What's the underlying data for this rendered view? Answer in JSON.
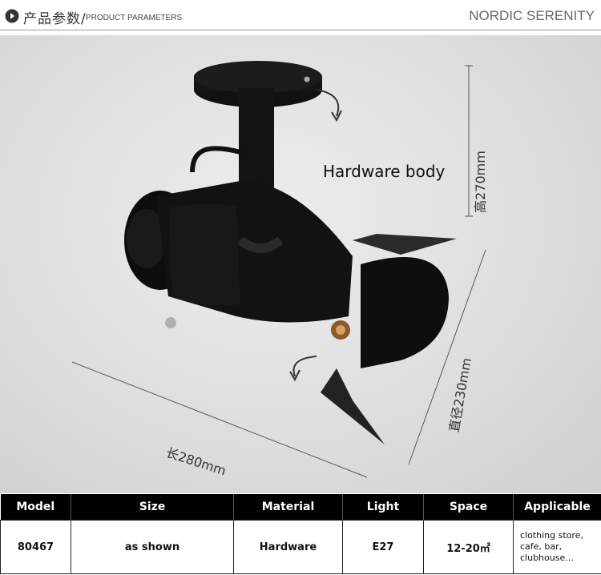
{
  "header": {
    "title_cn": "产品参数/",
    "title_en": "PRODUCT PARAMETERS",
    "brand": "NORDIC SERENITY",
    "icon": "play-circle-icon"
  },
  "photo": {
    "callout": "Hardware body",
    "dimensions": {
      "height": "高270mm",
      "diameter": "直径230mm",
      "length": "长280mm"
    }
  },
  "table": {
    "headers": [
      "Model",
      "Size",
      "Material",
      "Light",
      "Space",
      "Applicable"
    ],
    "row": {
      "model": "80467",
      "size": "as shown",
      "material": "Hardware",
      "light": "E27",
      "space": "12-20㎡",
      "applicable": "clothing store,\ncafe, bar,\nclubhouse..."
    }
  },
  "colors": {
    "table_header_bg": "#000000",
    "fixture_body": "#111111",
    "background": "#e2e2e2"
  }
}
